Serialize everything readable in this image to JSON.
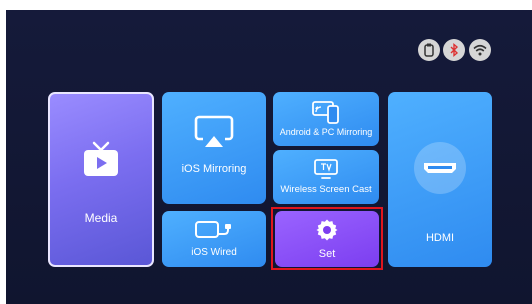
{
  "status_icons": [
    "usb-drive-icon",
    "bluetooth-off-icon",
    "wifi-icon"
  ],
  "tiles": {
    "media": {
      "label": "Media",
      "icon": "tv-icon"
    },
    "ios_mirroring": {
      "label": "iOS Mirroring",
      "icon": "airplay-icon"
    },
    "android_pc_mirroring": {
      "label": "Android & PC Mirroring",
      "icon": "phone-cast-icon"
    },
    "wireless_screen_cast": {
      "label": "Wireless Screen Cast",
      "icon": "tv-cast-icon"
    },
    "ios_wired": {
      "label": "iOS Wired",
      "icon": "cable-icon"
    },
    "set": {
      "label": "Set",
      "icon": "gear-icon",
      "selected": true
    },
    "hdmi": {
      "label": "HDMI",
      "icon": "hdmi-port-icon"
    }
  },
  "colors": {
    "background": "#151a3a",
    "tile_blue": "#2f8bf0",
    "tile_media": "#7b6ef0",
    "tile_set": "#7c3ef0",
    "selection_outline": "#e0161e"
  }
}
